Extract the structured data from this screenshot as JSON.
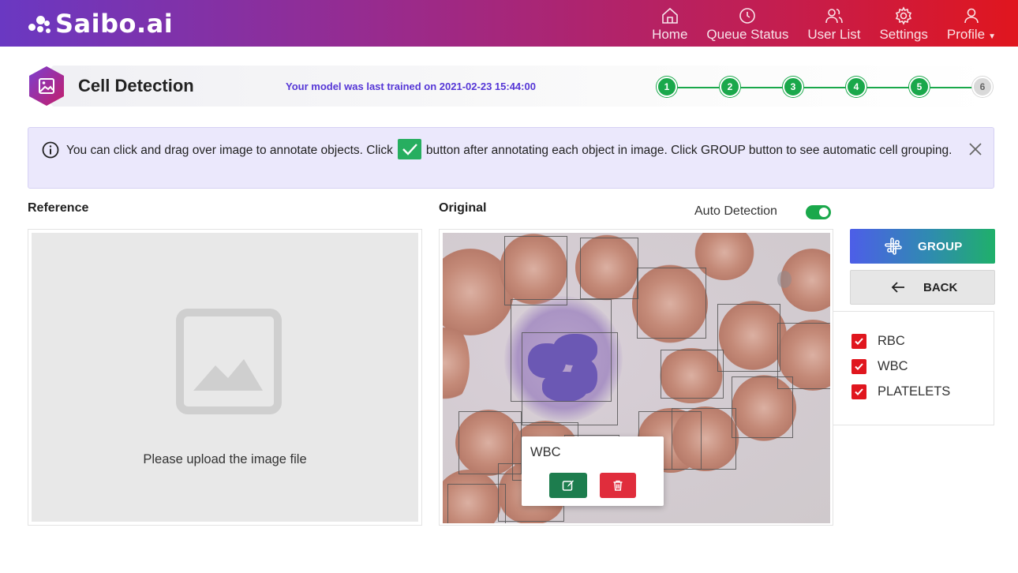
{
  "brand": {
    "name": "Saibo.ai"
  },
  "nav": [
    {
      "label": "Home",
      "icon": "home-icon"
    },
    {
      "label": "Queue Status",
      "icon": "clock-icon"
    },
    {
      "label": "User List",
      "icon": "users-icon"
    },
    {
      "label": "Settings",
      "icon": "gear-icon"
    },
    {
      "label": "Profile",
      "icon": "user-icon",
      "has_dropdown": true
    }
  ],
  "header": {
    "title": "Cell Detection",
    "trained_prefix": "Your model was last trained on ",
    "trained_timestamp": "2021-02-23 15:44:00",
    "steps": [
      {
        "label": "1",
        "done": true
      },
      {
        "label": "2",
        "done": true
      },
      {
        "label": "3",
        "done": true
      },
      {
        "label": "4",
        "done": true
      },
      {
        "label": "5",
        "done": true
      },
      {
        "label": "6",
        "done": false
      }
    ]
  },
  "info": {
    "text_before": "You can click and drag over image to annotate objects. Click",
    "text_after": "button after annotating each object in image. Click GROUP button to see automatic cell grouping."
  },
  "reference": {
    "label": "Reference",
    "placeholder": "Please upload the image file"
  },
  "original": {
    "label": "Original",
    "auto_detection_label": "Auto Detection",
    "auto_detection_on": true
  },
  "popup": {
    "label": "WBC"
  },
  "actions": {
    "group_label": "GROUP",
    "back_label": "BACK"
  },
  "legend": [
    {
      "label": "RBC",
      "checked": true
    },
    {
      "label": "WBC",
      "checked": true
    },
    {
      "label": "PLATELETS",
      "checked": true
    }
  ],
  "colors": {
    "brand_gradient_start": "#6a38c2",
    "brand_gradient_end": "#e0161e",
    "accent_purple": "#5536d6",
    "step_green": "#1aa84b",
    "checkbox_red": "#e0161e",
    "edit_green": "#1d7d4e",
    "delete_red": "#e02d3c"
  }
}
